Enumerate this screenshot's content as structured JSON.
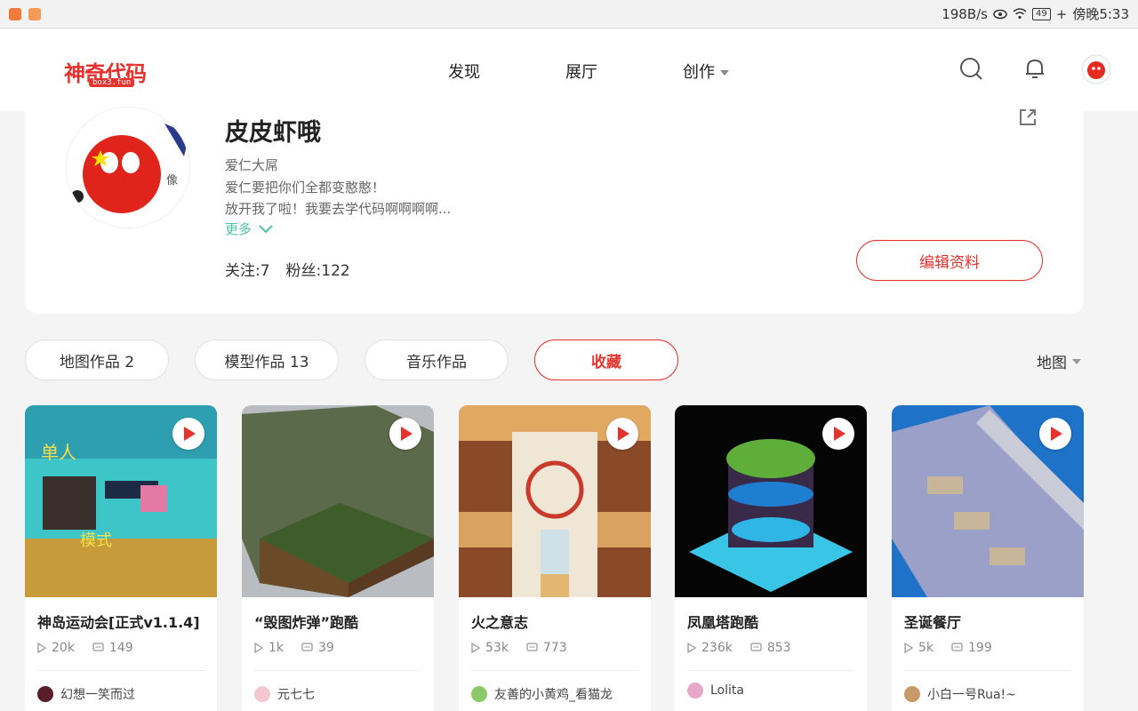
{
  "statusbar": {
    "speed": "198B/s",
    "battery": "49",
    "time": "傍晚5:33"
  },
  "header": {
    "logo_text": "神奇代码岛",
    "logo_sub": "box3.fun",
    "nav": [
      {
        "label": "发现"
      },
      {
        "label": "展厅"
      },
      {
        "label": "创作"
      }
    ]
  },
  "profile": {
    "name": "皮皮虾哦",
    "bio_lines": [
      "爱仁大屌",
      "爱仁要把你们全都变憨憨！",
      "放开我了啦！我要去学代码啊啊啊啊..."
    ],
    "more_label": "更多",
    "following": "关注:7",
    "followers": "粉丝:122",
    "edit_label": "编辑资料"
  },
  "tabs": [
    {
      "label": "地图作品 2"
    },
    {
      "label": "模型作品 13"
    },
    {
      "label": "音乐作品"
    },
    {
      "label": "收藏"
    }
  ],
  "filter": {
    "label": "地图"
  },
  "cards": [
    {
      "title": "神岛运动会[正式v1.1.4]",
      "views": "20k",
      "comments": "149",
      "author": "幻想一笑而过"
    },
    {
      "title": "“毁图炸弹”跑酷",
      "views": "1k",
      "comments": "39",
      "author": "元七七"
    },
    {
      "title": "火之意志",
      "views": "53k",
      "comments": "773",
      "author": "友善的小黄鸡_看猫龙"
    },
    {
      "title": "凤凰塔跑酷",
      "views": "236k",
      "comments": "853",
      "author": "Lolita"
    },
    {
      "title": "圣诞餐厅",
      "views": "5k",
      "comments": "199",
      "author": "小白一号Rua!~"
    }
  ],
  "colors": {
    "accent": "#e5322d",
    "more": "#4cc3a0"
  }
}
